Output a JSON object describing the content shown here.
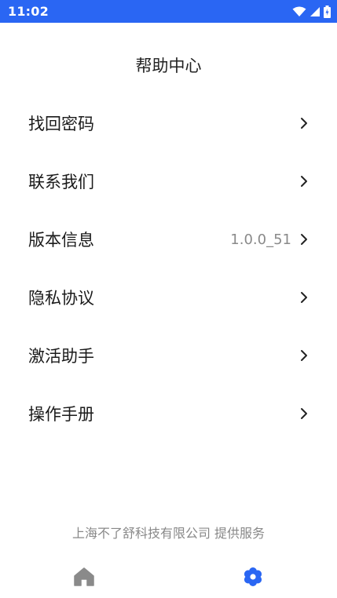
{
  "status_bar": {
    "time": "11:02",
    "icons": [
      "wifi-icon",
      "signal-icon",
      "battery-icon"
    ],
    "background": "#2a66f3"
  },
  "page": {
    "title": "帮助中心"
  },
  "menu": [
    {
      "label": "找回密码",
      "value": ""
    },
    {
      "label": "联系我们",
      "value": ""
    },
    {
      "label": "版本信息",
      "value": "1.0.0_51"
    },
    {
      "label": "隐私协议",
      "value": ""
    },
    {
      "label": "激活助手",
      "value": ""
    },
    {
      "label": "操作手册",
      "value": ""
    }
  ],
  "footer": {
    "text": "上海不了舒科技有限公司 提供服务"
  },
  "bottom_nav": {
    "items": [
      {
        "icon": "home-icon",
        "active": false
      },
      {
        "icon": "settings-gear-icon",
        "active": true
      }
    ],
    "active_color": "#2a66f3",
    "inactive_color": "#8a8a8a"
  }
}
